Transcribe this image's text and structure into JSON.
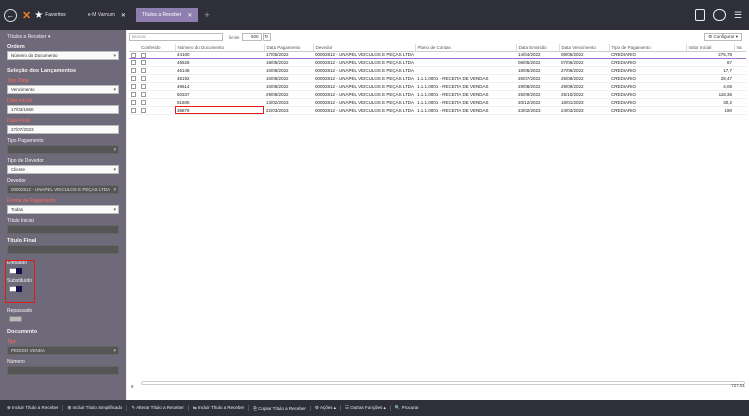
{
  "topbar": {
    "back_symbol": "←",
    "favorites_label": "Favoritos",
    "tabs": [
      {
        "label": "e-M Varnum",
        "active": false
      },
      {
        "label": "Títulos a Receber",
        "active": true
      }
    ],
    "close_symbol": "✕",
    "new_tab_symbol": "+"
  },
  "sidebar": {
    "section_title": "Títulos a Receber ▾",
    "ordem_label": "Ordem",
    "ordem_value": "Número do Documento",
    "selecao_label": "Seleção dos Lançamentos",
    "tipo_data_label": "Tipo Data",
    "tipo_data_value": "Vencimento",
    "data_inicial_label": "Data Inicial",
    "data_inicial_value": "17/03/1960",
    "data_final_label": "Data Final",
    "data_final_value": "27/07/2023",
    "tipo_pagamento_label": "Tipo Pagamento",
    "tipo_pagamento_value": "",
    "tipo_devedor_label": "Tipo de Devedor",
    "tipo_devedor_value": "Cliente",
    "devedor_label": "Devedor",
    "devedor_value": "00002812 - UNAPEL VEICULOS E PEÇAS LTDA",
    "forma_pagamento_label": "Forma de Pagamento",
    "forma_pagamento_value": "Todas",
    "titulo_inicial_label": "Título Inicial",
    "titulo_inicial_value": "",
    "titulo_final_label": "Título Final",
    "titulo_final_value": "",
    "efetuado_label": "Efetuado",
    "substituido_label": "Substituído",
    "repassado_label": "Repassado",
    "documento_label": "Documento",
    "tipo_label": "Tipo",
    "tipo_value": "PEDIDO VENDA",
    "numero_label": "Número",
    "numero_value": ""
  },
  "toolbar": {
    "search_placeholder": "Buscar",
    "limit_label": "limite",
    "limit_value": "500",
    "config_label": "Configurar ▾"
  },
  "table": {
    "headers": [
      "",
      "Conferido",
      "Número do Documento",
      "Data Pagamento",
      "Devedor",
      "Plano de Contas",
      "Data Emissão",
      "Data Vencimento",
      "Tipo de Pagamento",
      "Valor Inicial",
      "Va"
    ],
    "rows": [
      {
        "doc": "44100",
        "pag": "17/05/2022",
        "dev": "00002812 - UNAPEL VEICULOS E PEÇAS LTDA",
        "plano": "",
        "emis": "14/04/2022",
        "venc": "09/05/2022",
        "tipo": "CREDIARIO",
        "valor": "275,78"
      },
      {
        "doc": "45528",
        "pag": "18/05/2022",
        "dev": "00002812 - UNAPEL VEICULOS E PEÇAS LTDA",
        "plano": "",
        "emis": "08/05/2022",
        "venc": "07/06/2022",
        "tipo": "CREDIARIO",
        "valor": "67"
      },
      {
        "doc": "46148",
        "pag": "10/08/2022",
        "dev": "00002812 - UNAPEL VEICULOS E PEÇAS LTDA",
        "plano": "",
        "emis": "18/05/2022",
        "venc": "27/06/2022",
        "tipo": "CREDIARIO",
        "valor": "17,7"
      },
      {
        "doc": "48192",
        "pag": "10/08/2022",
        "dev": "00002812 - UNAPEL VEICULOS E PEÇAS LTDA",
        "plano": "1.1.1.0001 - RECEITA DE VENDAS",
        "emis": "26/07/2022",
        "venc": "25/08/2022",
        "tipo": "CREDIARIO",
        "valor": "28,47"
      },
      {
        "doc": "49614",
        "pag": "10/08/2022",
        "dev": "00002812 - UNAPEL VEICULOS E PEÇAS LTDA",
        "plano": "1.1.1.0001 - RECEITA DE VENDAS",
        "emis": "29/08/2022",
        "venc": "29/09/2022",
        "tipo": "CREDIARIO",
        "valor": "4,06"
      },
      {
        "doc": "50337",
        "pag": "29/08/2022",
        "dev": "00002812 - UNAPEL VEICULOS E PEÇAS LTDA",
        "plano": "1.1.1.0001 - RECEITA DE VENDAS",
        "emis": "25/09/2022",
        "venc": "25/10/2022",
        "tipo": "CREDIARIO",
        "valor": "118,36"
      },
      {
        "doc": "51605",
        "pag": "13/02/2023",
        "dev": "00002812 - UNAPEL VEICULOS E PEÇAS LTDA",
        "plano": "1.1.1.0001 - RECEITA DE VENDAS",
        "emis": "20/12/2022",
        "venc": "18/01/2023",
        "tipo": "CREDIARIO",
        "valor": "30,2"
      },
      {
        "doc": "36878",
        "pag": "22/03/2023",
        "dev": "00002812 - UNAPEL VEICULOS E PEÇAS LTDA",
        "plano": "1.1.1.0001 - RECEITA DE VENDAS",
        "emis": "23/02/2023",
        "venc": "24/03/2023",
        "tipo": "CREDIARIO",
        "valor": "190"
      }
    ],
    "row_count": "8",
    "total": "727,51"
  },
  "bottombar": {
    "buttons": [
      "⊕ Incluir Título a Receber",
      "⊞ Incluir Título Simplificado",
      "✎ Alterar Título a Receber",
      "⇆ Incluir Título a Receber",
      "⎘ Copiar Título a Receber",
      "⚙ Ações ▴",
      "☰ Outras Funções ▴",
      "🔍 Procurar"
    ]
  }
}
